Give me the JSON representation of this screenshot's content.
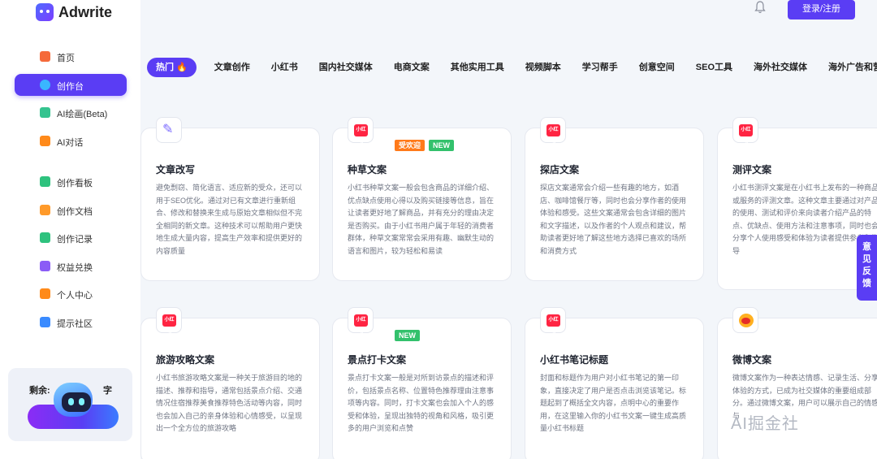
{
  "app": {
    "name": "Adwrite"
  },
  "header": {
    "login_label": "登录/注册"
  },
  "sidebar": {
    "items": [
      {
        "label": "首页",
        "icon": "home-icon",
        "color": "#f56a3a",
        "active": false
      },
      {
        "label": "创作台",
        "icon": "create-icon",
        "color": "#3ab6ff",
        "active": true
      },
      {
        "label": "AI绘画(Beta)",
        "icon": "painting-icon",
        "color": "#34c38f",
        "active": false
      },
      {
        "label": "AI对话",
        "icon": "ai-chat-icon",
        "color": "#ff8a1a",
        "active": false
      },
      {
        "label": "创作看板",
        "icon": "dashboard-icon",
        "color": "#2ec27e",
        "active": false
      },
      {
        "label": "创作文档",
        "icon": "document-icon",
        "color": "#ff9a2a",
        "active": false
      },
      {
        "label": "创作记录",
        "icon": "record-icon",
        "color": "#2ec27e",
        "active": false
      },
      {
        "label": "权益兑换",
        "icon": "exchange-icon",
        "color": "#8b5cf6",
        "active": false
      },
      {
        "label": "个人中心",
        "icon": "user-icon",
        "color": "#ff8a1a",
        "active": false
      },
      {
        "label": "提示社区",
        "icon": "community-icon",
        "color": "#3a8bff",
        "active": false
      }
    ],
    "promo": {
      "text_left": "剩余:",
      "text_right": "字"
    }
  },
  "tabs": [
    {
      "label": "热门 🔥",
      "active": true
    },
    {
      "label": "文章创作",
      "active": false
    },
    {
      "label": "小红书",
      "active": false
    },
    {
      "label": "国内社交媒体",
      "active": false
    },
    {
      "label": "电商文案",
      "active": false
    },
    {
      "label": "其他实用工具",
      "active": false
    },
    {
      "label": "视频脚本",
      "active": false
    },
    {
      "label": "学习帮手",
      "active": false
    },
    {
      "label": "创意空间",
      "active": false
    },
    {
      "label": "SEO工具",
      "active": false
    },
    {
      "label": "海外社交媒体",
      "active": false
    },
    {
      "label": "海外广告和营销工具",
      "active": false
    }
  ],
  "cards": [
    {
      "title": "文章改写",
      "icon": "pen-icon",
      "badges": [],
      "desc": "避免剽窃、简化语言、适应新的受众，还可以用于SEO优化。通过对已有文章进行重新组合、修改和替换来生成与原始文章相似但不完全相同的新文章。这种技术可以帮助用户更快地生成大量内容，提高生产效率和提供更好的内容质量"
    },
    {
      "title": "种草文案",
      "icon": "xiaohongshu-icon",
      "badges": [
        {
          "label": "受欢迎",
          "kind": "hot"
        },
        {
          "label": "NEW",
          "kind": "new"
        }
      ],
      "desc": "小红书种草文案一般会包含商品的详细介绍、优点缺点使用心得以及购买链接等信息，旨在让读者更好地了解商品，并有充分的理由决定是否购买。由于小红书用户属于年轻的消费者群体，种草文案常常会采用有趣、幽默生动的语言和图片，较为轻松和易读"
    },
    {
      "title": "探店文案",
      "icon": "xiaohongshu-icon",
      "badges": [],
      "desc": "探店文案通常会介绍一些有趣的地方，如酒店、咖啡馆餐厅等，同时也会分享作者的使用体验和感受。这些文案通常会包含详细的图片和文字描述，以及作者的个人观点和建议，帮助读者更好地了解这些地方选择已喜欢的场所和消费方式"
    },
    {
      "title": "测评文案",
      "icon": "xiaohongshu-icon",
      "badges": [],
      "desc": "小红书测评文案是在小红书上发布的一种商品或服务的评测文章。这种文章主要通过对产品的使用、测试和评价来向读者介绍产品的特点、优缺点、使用方法和注意事项，同时也会分享个人使用感受和体验为读者提供参考和指导"
    },
    {
      "title": "旅游攻略文案",
      "icon": "xiaohongshu-icon",
      "badges": [],
      "desc": "小红书旅游攻略文案是一种关于旅游目的地的描述、推荐和指导，通常包括景点介绍、交通情况住宿推荐美食推荐特色活动等内容，同时也会加入自己的亲身体验和心情感受，以呈现出一个全方位的旅游攻略"
    },
    {
      "title": "景点打卡文案",
      "icon": "xiaohongshu-icon",
      "badges": [
        {
          "label": "NEW",
          "kind": "new"
        }
      ],
      "desc": "景点打卡文案一般是对所到访景点的描述和评价，包括景点名称、位置特色推荐理由注意事项等内容。同时，打卡文案也会加入个人的感受和体验，呈现出独特的视角和风格，吸引更多的用户浏览和点赞"
    },
    {
      "title": "小红书笔记标题",
      "icon": "xiaohongshu-icon",
      "badges": [],
      "desc": "封面和标题作为用户对小红书笔记的第一印象，直接决定了用户是否点击浏览该笔记。标题起到了概括全文内容，点明中心的重要作用，在这里输入你的小红书文案一键生成高质量小红书标题"
    },
    {
      "title": "微博文案",
      "icon": "weibo-icon",
      "badges": [],
      "desc": "微博文案作为一种表达情感、记录生活、分享体验的方式，已成为社交媒体的重要组成部分。通过微博文案，用户可以展示自己的情感与"
    }
  ],
  "icon_text": {
    "xiaohongshu": "小红书"
  },
  "feedback_label": "意见反馈",
  "watermark": "AI掘金社"
}
